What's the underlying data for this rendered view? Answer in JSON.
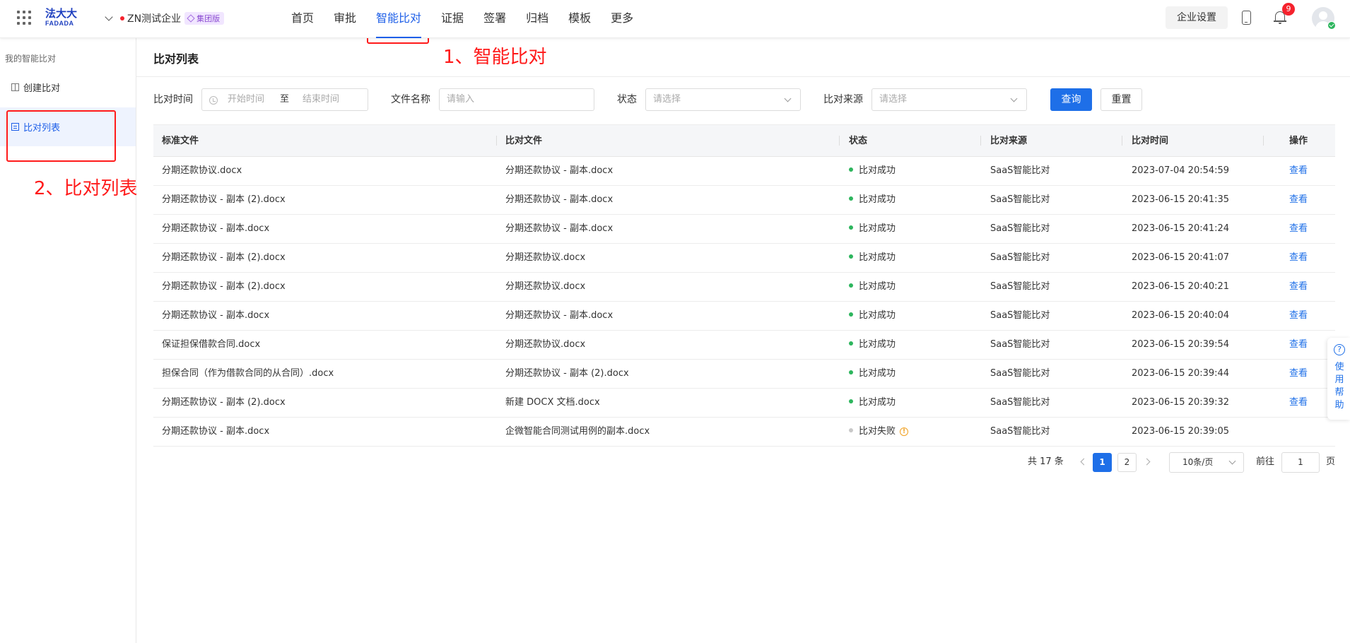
{
  "header": {
    "logo_cn": "法大大",
    "logo_en": "FADADA",
    "org_name": "ZN测试企业",
    "org_badge": "集团版",
    "nav": [
      "首页",
      "审批",
      "智能比对",
      "证据",
      "签署",
      "归档",
      "模板",
      "更多"
    ],
    "active_nav": "智能比对",
    "settings_label": "企业设置",
    "notification_count": "9"
  },
  "sidebar": {
    "section_title": "我的智能比对",
    "items": [
      {
        "label": "创建比对",
        "icon": "columns-icon"
      },
      {
        "label": "比对列表",
        "icon": "list-icon"
      }
    ]
  },
  "annotations": {
    "step1": "1、智能比对",
    "step2": "2、比对列表",
    "color": "#ff1a1a"
  },
  "main": {
    "title": "比对列表",
    "filters": {
      "time_label": "比对时间",
      "start_placeholder": "开始时间",
      "range_sep": "至",
      "end_placeholder": "结束时间",
      "filename_label": "文件名称",
      "filename_placeholder": "请输入",
      "status_label": "状态",
      "status_placeholder": "请选择",
      "source_label": "比对来源",
      "source_placeholder": "请选择",
      "query_button": "查询",
      "reset_button": "重置"
    },
    "table": {
      "columns": [
        "标准文件",
        "比对文件",
        "状态",
        "比对来源",
        "比对时间",
        "操作"
      ],
      "rows": [
        {
          "standard": "分期还款协议.docx",
          "compare": "分期还款协议 - 副本.docx",
          "status": "比对成功",
          "ok": true,
          "source": "SaaS智能比对",
          "time": "2023-07-04 20:54:59",
          "action": "查看"
        },
        {
          "standard": "分期还款协议 - 副本 (2).docx",
          "compare": "分期还款协议 - 副本.docx",
          "status": "比对成功",
          "ok": true,
          "source": "SaaS智能比对",
          "time": "2023-06-15 20:41:35",
          "action": "查看"
        },
        {
          "standard": "分期还款协议 - 副本.docx",
          "compare": "分期还款协议 - 副本.docx",
          "status": "比对成功",
          "ok": true,
          "source": "SaaS智能比对",
          "time": "2023-06-15 20:41:24",
          "action": "查看"
        },
        {
          "standard": "分期还款协议 - 副本 (2).docx",
          "compare": "分期还款协议.docx",
          "status": "比对成功",
          "ok": true,
          "source": "SaaS智能比对",
          "time": "2023-06-15 20:41:07",
          "action": "查看"
        },
        {
          "standard": "分期还款协议 - 副本 (2).docx",
          "compare": "分期还款协议.docx",
          "status": "比对成功",
          "ok": true,
          "source": "SaaS智能比对",
          "time": "2023-06-15 20:40:21",
          "action": "查看"
        },
        {
          "standard": "分期还款协议 - 副本.docx",
          "compare": "分期还款协议 - 副本.docx",
          "status": "比对成功",
          "ok": true,
          "source": "SaaS智能比对",
          "time": "2023-06-15 20:40:04",
          "action": "查看"
        },
        {
          "standard": "保证担保借款合同.docx",
          "compare": "分期还款协议.docx",
          "status": "比对成功",
          "ok": true,
          "source": "SaaS智能比对",
          "time": "2023-06-15 20:39:54",
          "action": "查看"
        },
        {
          "standard": "担保合同（作为借款合同的从合同）.docx",
          "compare": "分期还款协议 - 副本 (2).docx",
          "status": "比对成功",
          "ok": true,
          "source": "SaaS智能比对",
          "time": "2023-06-15 20:39:44",
          "action": "查看"
        },
        {
          "standard": "分期还款协议 - 副本 (2).docx",
          "compare": "新建 DOCX 文档.docx",
          "status": "比对成功",
          "ok": true,
          "source": "SaaS智能比对",
          "time": "2023-06-15 20:39:32",
          "action": "查看"
        },
        {
          "standard": "分期还款协议 - 副本.docx",
          "compare": "企微智能合同测试用例的副本.docx",
          "status": "比对失败",
          "ok": false,
          "source": "SaaS智能比对",
          "time": "2023-06-15 20:39:05",
          "action": ""
        }
      ]
    },
    "pagination": {
      "total": "共 17 条",
      "pages": [
        "1",
        "2"
      ],
      "current": "1",
      "page_size": "10条/页",
      "goto_label": "前往",
      "goto_value": "1",
      "page_suffix": "页"
    }
  },
  "help": {
    "label": "使用帮助"
  },
  "colors": {
    "primary": "#1e6fe8",
    "success_dot": "#2db55d",
    "fail_dot": "#c8c8c8",
    "badge_red": "#f5222d"
  }
}
